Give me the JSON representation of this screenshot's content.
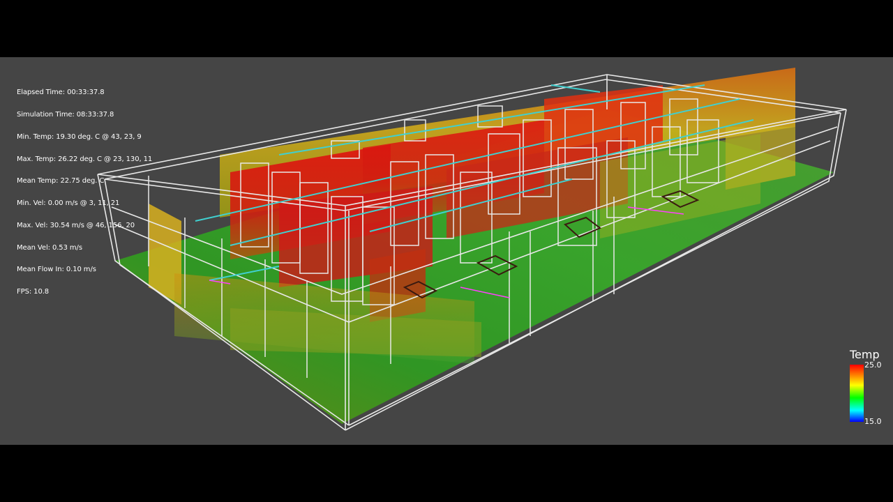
{
  "stats": {
    "lines": [
      "Elapsed Time: 00:33:37.8",
      "Simulation Time: 08:33:37.8",
      "Min. Temp: 19.30 deg. C @ 43, 23, 9",
      "Max. Temp: 26.22 deg. C @ 23, 130, 11",
      "Mean Temp: 22.75 deg. C",
      "Min. Vel: 0.00 m/s @ 3, 11, 21",
      "Max. Vel: 30.54 m/s @ 46, 156, 20",
      "Mean Vel: 0.53 m/s",
      "Mean Flow In: 0.10 m/s",
      "FPS: 10.8"
    ]
  },
  "legend": {
    "title": "Temp",
    "max": "25.0",
    "min": "15.0"
  },
  "colors": {
    "background": "#454545",
    "hot": "#e01010",
    "warm": "#d8c020",
    "cool": "#20a020",
    "wireframe": "#e8e8e8",
    "duct": "#40d0d0",
    "accent": "#ff40ff"
  }
}
